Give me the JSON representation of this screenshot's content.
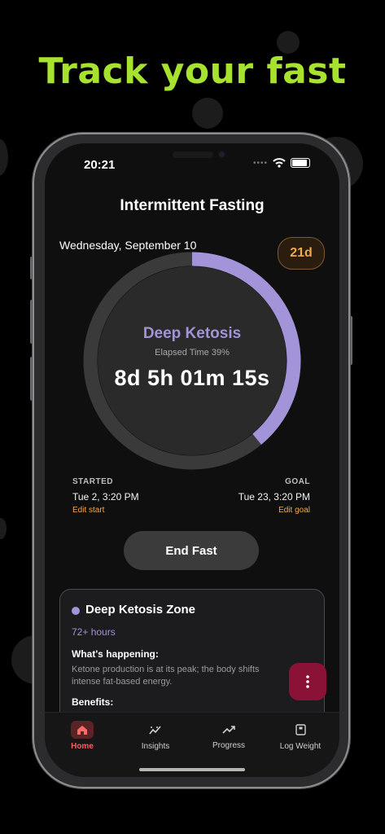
{
  "headline": "Track your fast",
  "status": {
    "time": "20:21"
  },
  "app": {
    "title": "Intermittent Fasting"
  },
  "date": "Wednesday, September 10",
  "badge": "21d",
  "progress": {
    "phase": "Deep Ketosis",
    "elapsed_label": "Elapsed Time 39%",
    "fraction": 0.39,
    "timer": "8d 5h 01m 15s",
    "ring_color": "#a393d8",
    "track_color": "#3a3a3a"
  },
  "started": {
    "label": "STARTED",
    "value": "Tue 2, 3:20 PM",
    "edit": "Edit start"
  },
  "goal": {
    "label": "GOAL",
    "value": "Tue 23, 3:20 PM",
    "edit": "Edit goal"
  },
  "end_button": "End Fast",
  "zone_card": {
    "title": "Deep Ketosis Zone",
    "hours": "72+ hours",
    "happening_label": "What's happening:",
    "happening_text": "Ketone production is at its peak; the body shifts\nintense fat-based energy.",
    "benefits_label": "Benefits:"
  },
  "fab_icon": "more-vertical-icon",
  "tabs": [
    {
      "label": "Home",
      "icon": "home-icon",
      "active": true
    },
    {
      "label": "Insights",
      "icon": "insights-icon",
      "active": false
    },
    {
      "label": "Progress",
      "icon": "trend-up-icon",
      "active": false
    },
    {
      "label": "Log Weight",
      "icon": "weight-scale-icon",
      "active": false
    }
  ],
  "colors": {
    "accent": "#a6e22e",
    "phase": "#a393d8",
    "orange": "#f0a94b",
    "active_tab": "#ff5a5a",
    "fab": "#8a1237"
  }
}
